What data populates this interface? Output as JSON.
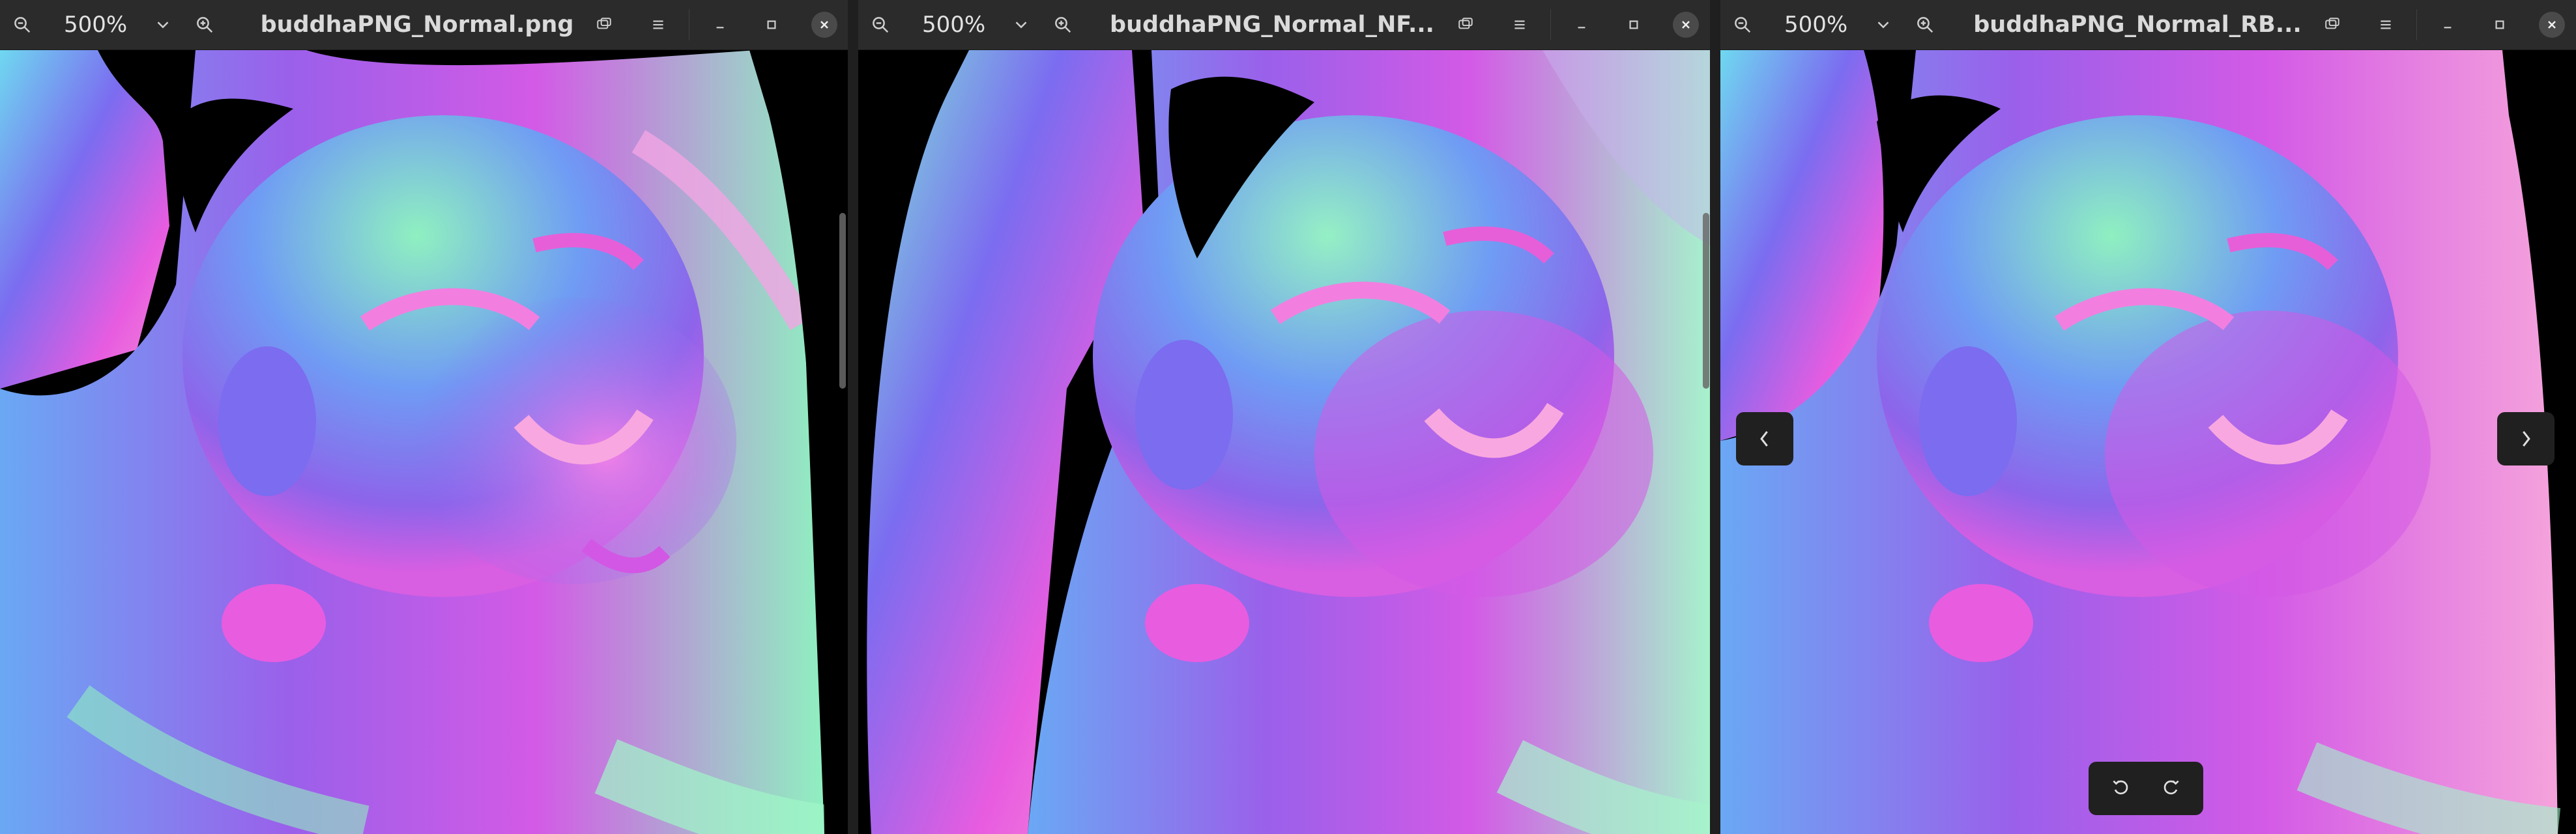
{
  "windows": [
    {
      "title": "buddhaPNG_Normal.png",
      "zoom": "500%"
    },
    {
      "title": "buddhaPNG_Normal_NF...",
      "zoom": "500%"
    },
    {
      "title": "buddhaPNG_Normal_RB...",
      "zoom": "500%"
    }
  ],
  "icons": {
    "zoom_out": "zoom-out-icon",
    "zoom_in": "zoom-in-icon",
    "dropdown": "chevron-down-icon",
    "pip": "picture-in-picture-icon",
    "menu": "hamburger-menu-icon",
    "minimize": "minimize-icon",
    "maximize": "maximize-icon",
    "close": "close-icon",
    "prev": "chevron-left-icon",
    "next": "chevron-right-icon",
    "rotate_left": "rotate-left-icon",
    "rotate_right": "rotate-right-icon"
  },
  "colors": {
    "header_bg": "#2b2b2b",
    "title_text": "#dadada",
    "image_pink": "#e85ce0",
    "image_blue": "#7b6cf0",
    "image_green": "#8ff0c0",
    "image_cyan": "#6fd8f0"
  }
}
